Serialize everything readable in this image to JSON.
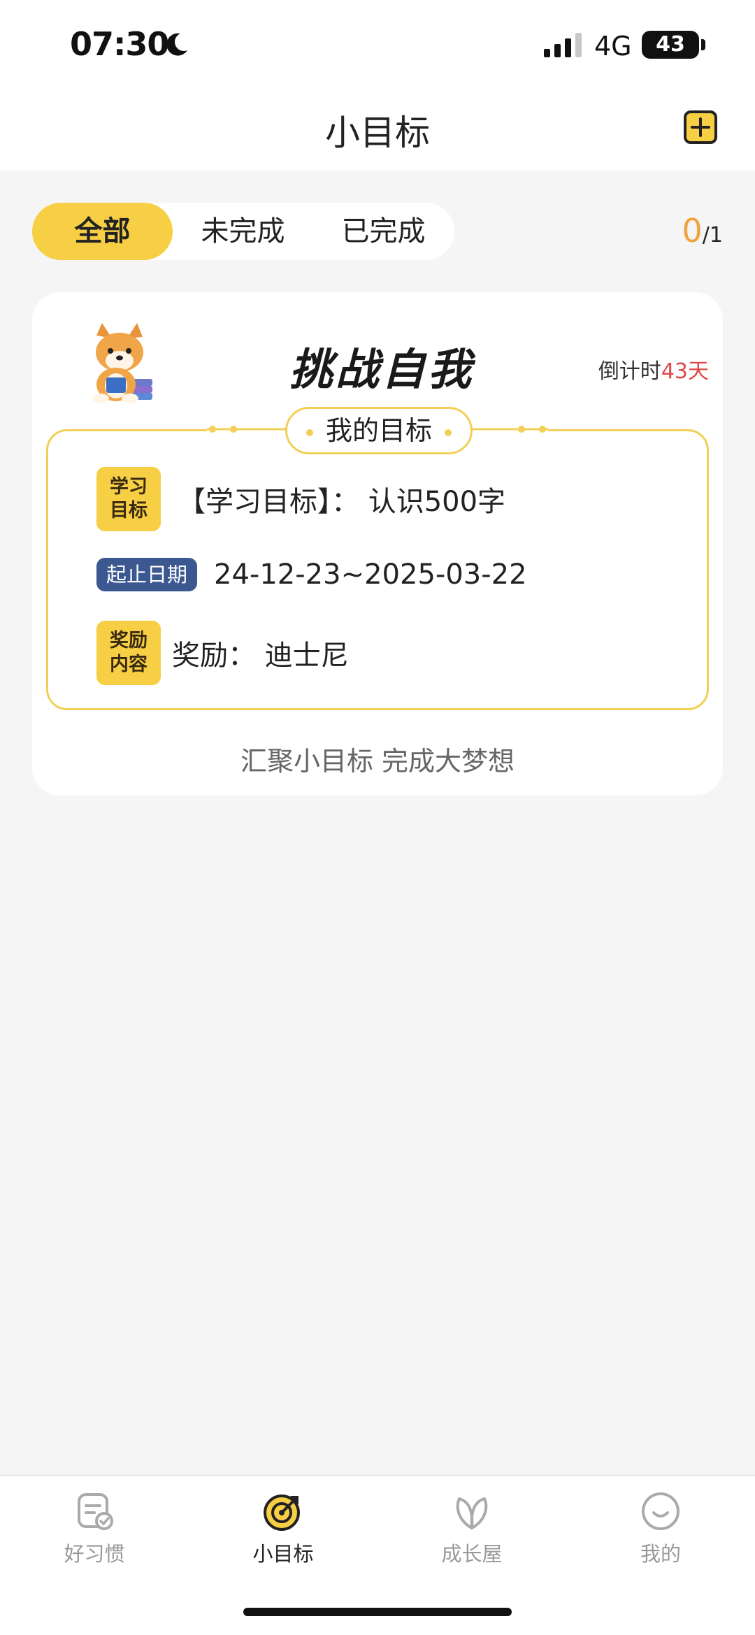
{
  "status_bar": {
    "time": "07:30",
    "network": "4G",
    "battery": "43"
  },
  "header": {
    "title": "小目标",
    "add_icon": "add-square-icon"
  },
  "tabs": [
    {
      "label": "全部",
      "active": true
    },
    {
      "label": "未完成",
      "active": false
    },
    {
      "label": "已完成",
      "active": false
    }
  ],
  "counter": {
    "completed": "0",
    "total": "/1"
  },
  "goal_card": {
    "title": "挑战自我",
    "countdown_prefix": "倒计时",
    "countdown_days": "43天",
    "section_title": "我的目标",
    "goal_badge_line1": "学习",
    "goal_badge_line2": "目标",
    "goal_text": "【学习目标】： 认识500字",
    "date_badge": "起止日期",
    "date_text": "24-12-23~2025-03-22",
    "reward_badge_line1": "奖励",
    "reward_badge_line2": "内容",
    "reward_text": "奖励： 迪士尼",
    "slogan": "汇聚小目标 完成大梦想",
    "accent_color": "#f7cf45"
  },
  "bottom_nav": [
    {
      "label": "好习惯",
      "icon": "habit-checklist-icon",
      "active": false
    },
    {
      "label": "小目标",
      "icon": "target-icon",
      "active": true
    },
    {
      "label": "成长屋",
      "icon": "leaf-icon",
      "active": false
    },
    {
      "label": "我的",
      "icon": "smile-face-icon",
      "active": false
    }
  ]
}
